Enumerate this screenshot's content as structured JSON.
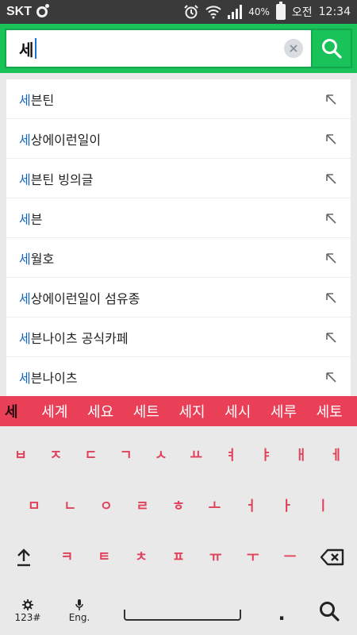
{
  "status_bar": {
    "carrier": "SKT",
    "battery": "40%",
    "ampm": "오전",
    "time": "12:34"
  },
  "search": {
    "query": "세",
    "icons": {
      "clear": "clear-icon",
      "search": "search-icon"
    }
  },
  "colors": {
    "search_green": "#19c35a",
    "highlight_blue": "#1565b8",
    "keyboard_accent": "#e94058"
  },
  "suggestions": [
    {
      "prefix": "세",
      "rest": "븐틴"
    },
    {
      "prefix": "세",
      "rest": "상에이런일이"
    },
    {
      "prefix": "세",
      "rest": "븐틴 빙의글"
    },
    {
      "prefix": "세",
      "rest": "븐"
    },
    {
      "prefix": "세",
      "rest": "월호"
    },
    {
      "prefix": "세",
      "rest": "상에이런일이 섬유종"
    },
    {
      "prefix": "세",
      "rest": "븐나이츠 공식카페"
    },
    {
      "prefix": "세",
      "rest": "븐나이츠"
    }
  ],
  "keyboard": {
    "candidates": [
      "세",
      "세계",
      "세요",
      "세트",
      "세지",
      "세시",
      "세루",
      "세토"
    ],
    "row1": [
      "ㅂ",
      "ㅈ",
      "ㄷ",
      "ㄱ",
      "ㅅ",
      "ㅛ",
      "ㅕ",
      "ㅑ",
      "ㅐ",
      "ㅔ"
    ],
    "row2": [
      "ㅁ",
      "ㄴ",
      "ㅇ",
      "ㄹ",
      "ㅎ",
      "ㅗ",
      "ㅓ",
      "ㅏ",
      "ㅣ"
    ],
    "row3": [
      "ㅋ",
      "ㅌ",
      "ㅊ",
      "ㅍ",
      "ㅠ",
      "ㅜ",
      "ㅡ"
    ],
    "num_label": "123#",
    "lang_label": "Eng.",
    "period": "."
  }
}
